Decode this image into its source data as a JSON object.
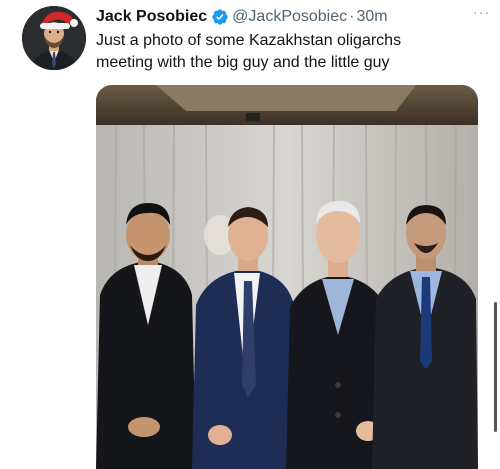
{
  "author": {
    "display_name": "Jack Posobiec",
    "handle": "@JackPosobiec",
    "separator": "·",
    "time": "30m"
  },
  "tweet": {
    "text_line1": "Just a photo of some Kazakhstan oligarchs",
    "text_line2": "meeting with the big guy and the little guy"
  },
  "icons": {
    "verified": "verified-badge-icon",
    "more": "more-options-icon"
  },
  "more_label": "···",
  "colors": {
    "text_primary": "#0f1419",
    "text_secondary": "#536471",
    "verified_blue": "#1d9bf0"
  }
}
